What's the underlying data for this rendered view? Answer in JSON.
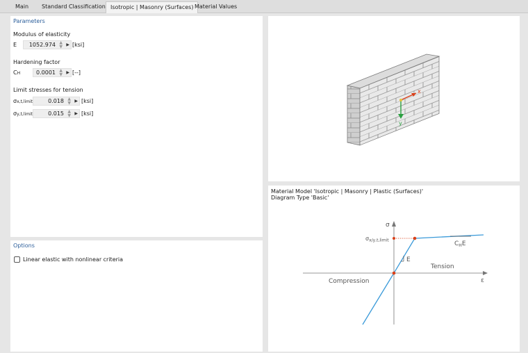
{
  "tabs": [
    "Main",
    "Standard Classification",
    "Isotropic | Masonry (Surfaces)",
    "Material Values"
  ],
  "parameters": {
    "title": "Parameters",
    "modulus_heading": "Modulus of elasticity",
    "e_symbol": "E",
    "e_value": "1052.974",
    "e_unit": "[ksi]",
    "hardening_heading": "Hardening factor",
    "ch_symbol": "C",
    "ch_sub": "H",
    "ch_value": "0.0001",
    "ch_unit": "[--]",
    "limit_heading": "Limit stresses for tension",
    "sx_symbol": "σ",
    "sx_sub": "x,t,limit",
    "sx_value": "0.018",
    "sx_unit": "[ksi]",
    "sy_symbol": "σ",
    "sy_sub": "y,t,limit",
    "sy_value": "0.015",
    "sy_unit": "[ksi]"
  },
  "options": {
    "title": "Options",
    "linear_elastic_label": "Linear elastic with nonlinear criteria",
    "linear_elastic_checked": false
  },
  "wall_axes": {
    "x": "x",
    "y": "y"
  },
  "diagram": {
    "line1": "Material Model 'Isotropic | Masonry | Plastic (Surfaces)'",
    "line2": "Diagram Type 'Basic'",
    "sigma": "σ",
    "epsilon": "ε",
    "sigma_limit_main": "σ",
    "sigma_limit_sub": "x/y,t,limit",
    "ch_e_main": "C",
    "ch_e_sub": "H",
    "ch_e_end": "E",
    "e_label": "E",
    "tension": "Tension",
    "compression": "Compression"
  },
  "colors": {
    "accent": "#2a5d9a",
    "curve": "#3a9ad9",
    "point": "#d9401a",
    "axis_x": "#d9401a",
    "axis_y": "#2aa040"
  }
}
